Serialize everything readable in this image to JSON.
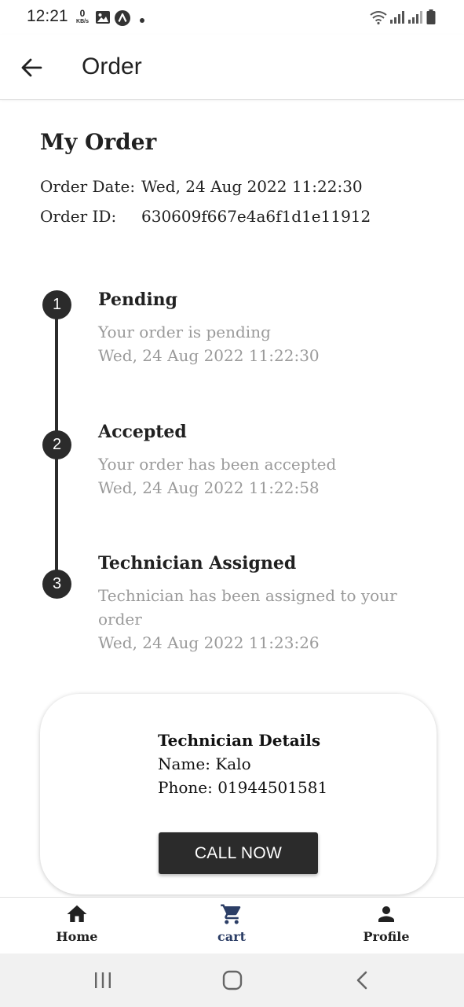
{
  "status_bar": {
    "time": "12:21",
    "net_speed_value": "0",
    "net_speed_unit": "KB/s"
  },
  "app_bar": {
    "back_icon": "arrow-left-icon",
    "title": "Order"
  },
  "order": {
    "heading": "My Order",
    "date_label": "Order Date:",
    "date_value": "Wed, 24 Aug 2022 11:22:30",
    "id_label": "Order ID:",
    "id_value": "630609f667e4a6f1d1e11912"
  },
  "timeline": [
    {
      "step": "1",
      "title": "Pending",
      "description": "Your order is pending",
      "timestamp": "Wed, 24 Aug 2022 11:22:30"
    },
    {
      "step": "2",
      "title": "Accepted",
      "description": "Your order has been accepted",
      "timestamp": "Wed, 24 Aug 2022 11:22:58"
    },
    {
      "step": "3",
      "title": "Technician Assigned",
      "description": "Technician has been assigned to your order",
      "timestamp": "Wed, 24 Aug 2022 11:23:26"
    }
  ],
  "technician": {
    "title": "Technician Details",
    "name_line": "Name: Kalo",
    "phone_line": "Phone: 01944501581",
    "call_button": "CALL NOW"
  },
  "bottom_nav": {
    "items": [
      {
        "label": "Home",
        "icon": "home-icon",
        "active": false
      },
      {
        "label": "cart",
        "icon": "cart-icon",
        "active": true
      },
      {
        "label": "Profile",
        "icon": "person-icon",
        "active": false
      }
    ],
    "active_color": "#2c3e66",
    "inactive_color": "#212121"
  },
  "colors": {
    "primary_dark": "#2b2b2b",
    "muted_text": "#9a9a9a"
  }
}
